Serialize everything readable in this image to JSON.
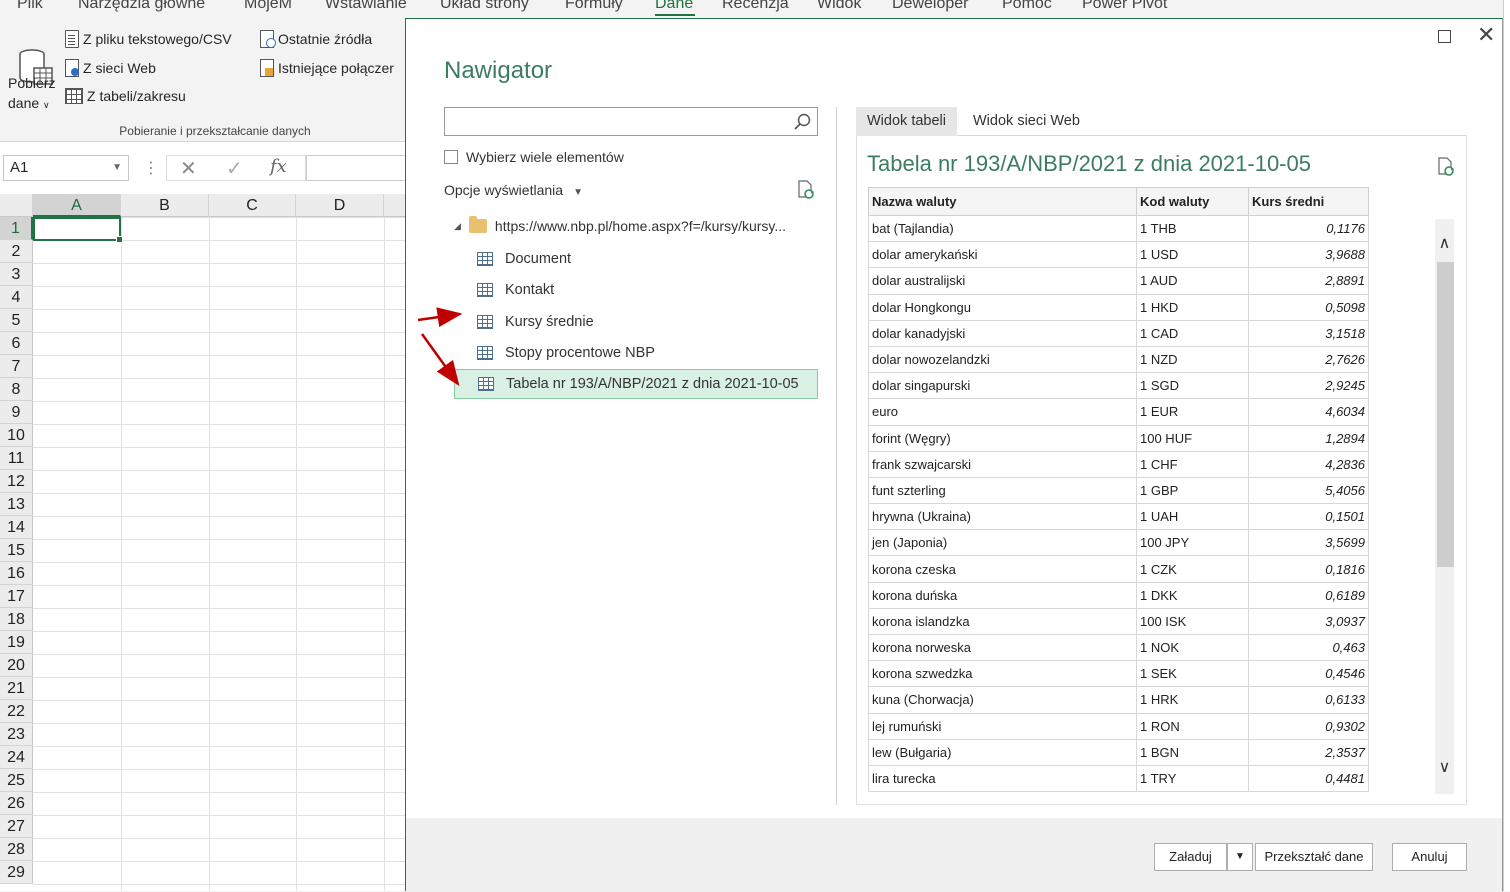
{
  "ribbon": {
    "tabs": [
      "Plik",
      "Narzędzia główne",
      "MojeM",
      "Wstawianie",
      "Układ strony",
      "Formuły",
      "Dane",
      "Recenzja",
      "Widok",
      "Deweloper",
      "Pomoc",
      "Power Pivot"
    ],
    "active_tab": "Dane",
    "get_data_label1": "Pobierz",
    "get_data_label2": "dane",
    "from_text_csv": "Z pliku tekstowego/CSV",
    "from_web": "Z sieci Web",
    "from_table": "Z tabeli/zakresu",
    "recent_sources": "Ostatnie źródła",
    "existing_connections": "Istniejące połączer",
    "group_label": "Pobieranie i przekształcanie danych"
  },
  "formula_bar": {
    "name_box": "A1",
    "fx": "fx"
  },
  "sheet": {
    "columns": [
      "A",
      "B",
      "C",
      "D"
    ],
    "rows": [
      "1",
      "2",
      "3",
      "4",
      "5",
      "6",
      "7",
      "8",
      "9",
      "10",
      "11",
      "12",
      "13",
      "14",
      "15",
      "16",
      "17",
      "18",
      "19",
      "20",
      "21",
      "22",
      "23",
      "24",
      "25",
      "26",
      "27",
      "28",
      "29"
    ]
  },
  "navigator": {
    "title": "Nawigator",
    "search_placeholder": "",
    "select_multiple": "Wybierz wiele elementów",
    "display_options": "Opcje wyświetlania",
    "root_url": "https://www.nbp.pl/home.aspx?f=/kursy/kursy...",
    "items": [
      {
        "label": "Document"
      },
      {
        "label": "Kontakt"
      },
      {
        "label": "Kursy średnie"
      },
      {
        "label": "Stopy procentowe NBP"
      },
      {
        "label": "Tabela nr 193/A/NBP/2021 z dnia 2021-10-05"
      }
    ],
    "selected_item": "Tabela nr 193/A/NBP/2021 z dnia 2021-10-05"
  },
  "preview": {
    "tab_table": "Widok tabeli",
    "tab_web": "Widok sieci Web",
    "title": "Tabela nr 193/A/NBP/2021 z dnia 2021-10-05",
    "columns": [
      "Nazwa waluty",
      "Kod waluty",
      "Kurs średni"
    ],
    "rows": [
      [
        "bat (Tajlandia)",
        "1 THB",
        "0,1176"
      ],
      [
        "dolar amerykański",
        "1 USD",
        "3,9688"
      ],
      [
        "dolar australijski",
        "1 AUD",
        "2,8891"
      ],
      [
        "dolar Hongkongu",
        "1 HKD",
        "0,5098"
      ],
      [
        "dolar kanadyjski",
        "1 CAD",
        "3,1518"
      ],
      [
        "dolar nowozelandzki",
        "1 NZD",
        "2,7626"
      ],
      [
        "dolar singapurski",
        "1 SGD",
        "2,9245"
      ],
      [
        "euro",
        "1 EUR",
        "4,6034"
      ],
      [
        "forint (Węgry)",
        "100 HUF",
        "1,2894"
      ],
      [
        "frank szwajcarski",
        "1 CHF",
        "4,2836"
      ],
      [
        "funt szterling",
        "1 GBP",
        "5,4056"
      ],
      [
        "hrywna (Ukraina)",
        "1 UAH",
        "0,1501"
      ],
      [
        "jen (Japonia)",
        "100 JPY",
        "3,5699"
      ],
      [
        "korona czeska",
        "1 CZK",
        "0,1816"
      ],
      [
        "korona duńska",
        "1 DKK",
        "0,6189"
      ],
      [
        "korona islandzka",
        "100 ISK",
        "3,0937"
      ],
      [
        "korona norweska",
        "1 NOK",
        "0,463"
      ],
      [
        "korona szwedzka",
        "1 SEK",
        "0,4546"
      ],
      [
        "kuna (Chorwacja)",
        "1 HRK",
        "0,6133"
      ],
      [
        "lej rumuński",
        "1 RON",
        "0,9302"
      ],
      [
        "lew (Bułgaria)",
        "1 BGN",
        "2,3537"
      ],
      [
        "lira turecka",
        "1 TRY",
        "0,4481"
      ]
    ]
  },
  "footer": {
    "load": "Załaduj",
    "transform": "Przekształć dane",
    "cancel": "Anuluj"
  },
  "colors": {
    "excel_green": "#217346",
    "title_green": "#3c7d60",
    "selection_bg": "#d9f1e2",
    "arrow_red": "#c00000"
  }
}
